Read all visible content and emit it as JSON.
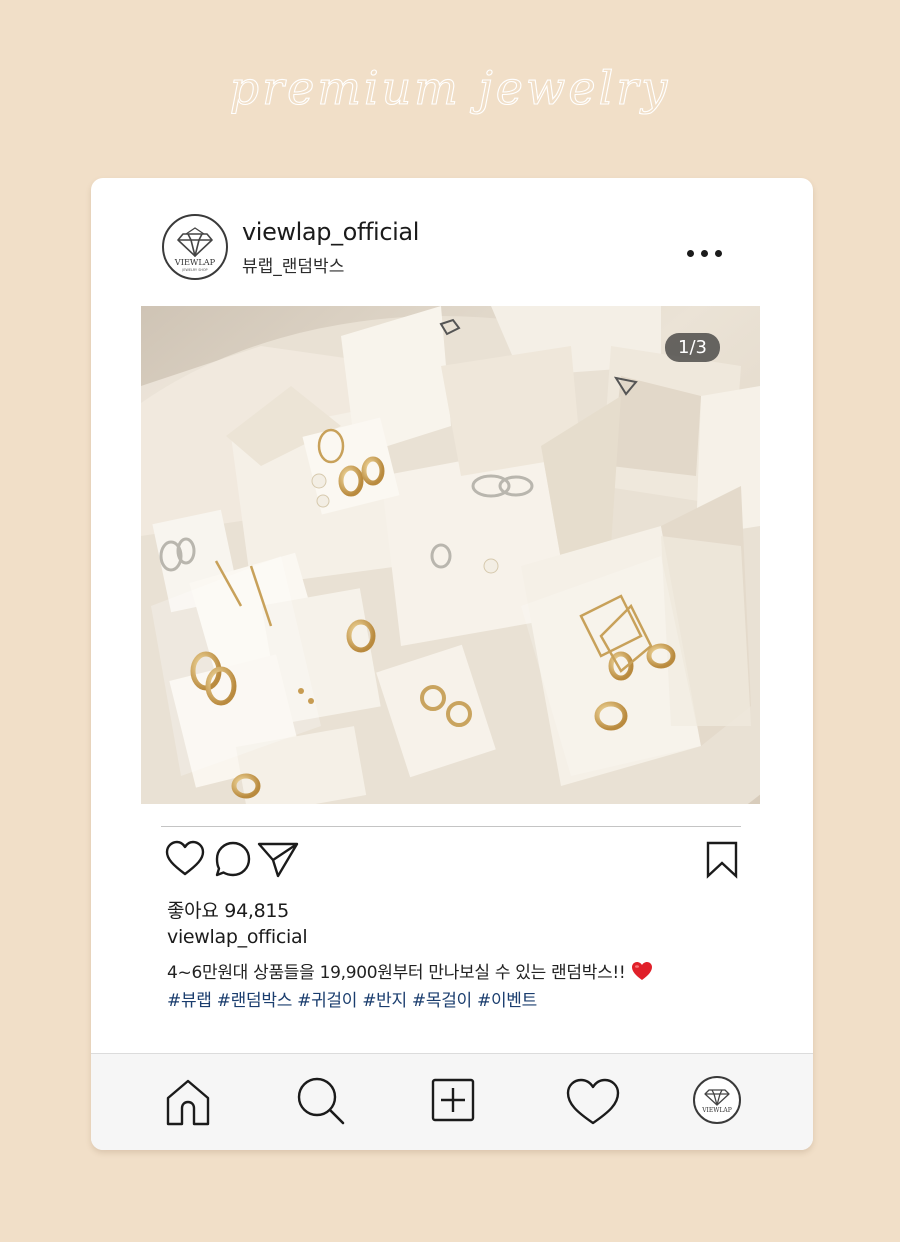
{
  "page": {
    "heading": "premium jewelry",
    "background_color": "#f1dfc8"
  },
  "post": {
    "avatar_logo_text": "VIEWLAP",
    "avatar_logo_subtext": "JEWELRY SHOP",
    "username": "viewlap_official",
    "subtitle": "뷰랩_랜덤박스",
    "image_counter": "1/3",
    "likes_text": "좋아요 94,815",
    "caption_username": "viewlap_official",
    "caption_text": "4~6만원대 상품들을 19,900원부터 만나보실 수 있는 랜덤박스!!",
    "caption_emoji": "❤️",
    "hashtags": "#뷰랩 #랜덤박스 #귀걸이 #반지 #목걸이 #이벤트"
  },
  "actions": {
    "icons": [
      "heart-icon",
      "comment-icon",
      "send-icon",
      "bookmark-icon"
    ]
  },
  "bottom_nav": {
    "icons": [
      "home-icon",
      "search-icon",
      "add-post-icon",
      "activity-heart-icon",
      "profile-avatar"
    ],
    "avatar_logo_text": "VIEWLAP"
  },
  "colors": {
    "hashtag": "#1a3d6e",
    "text": "#1b1b1b",
    "heart_emoji": "#e0202a"
  }
}
